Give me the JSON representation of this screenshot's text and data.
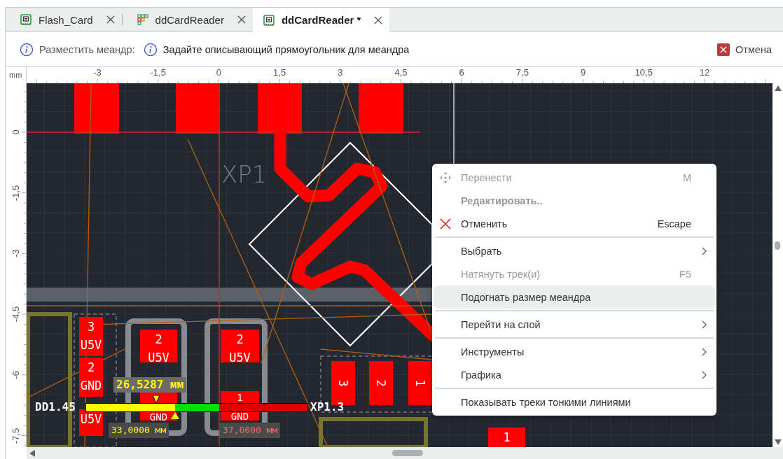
{
  "tabs": [
    {
      "label": "Flash_Card",
      "kind": "board",
      "selected": false
    },
    {
      "label": "ddCardReader",
      "kind": "schematic",
      "selected": false
    },
    {
      "label": "ddCardReader *",
      "kind": "board",
      "selected": true
    }
  ],
  "toolbar": {
    "command": "Разместить меандр:",
    "hint": "Задайте описывающий прямоугольник для меандра",
    "cancel": "Отмена"
  },
  "ruler": {
    "unit": "mm",
    "x_labels": [
      "-3",
      "-1,5",
      "0",
      "1,5",
      "3",
      "4,5",
      "6",
      "7,5",
      "9",
      "10,5",
      "12"
    ],
    "y_labels": [
      "0",
      "-1,5",
      "-3",
      "-4,5",
      "-6",
      "-7,5"
    ]
  },
  "canvas": {
    "designator": "XP1",
    "pads": [
      {
        "lines": [
          "3",
          "U5V"
        ],
        "kind": "h"
      },
      {
        "lines": [
          "2",
          "GND"
        ],
        "kind": "h"
      },
      {
        "lines": [
          "U5V"
        ],
        "kind": "h"
      },
      {
        "lines": [
          "2",
          "U5V"
        ],
        "kind": "h"
      },
      {
        "lines": [
          "GND"
        ],
        "kind": "h"
      },
      {
        "lines": [
          "2",
          "U5V"
        ],
        "kind": "h"
      },
      {
        "lines": [
          "1",
          "GND"
        ],
        "kind": "h"
      },
      {
        "lines": [
          "3"
        ],
        "kind": "v"
      },
      {
        "lines": [
          "2"
        ],
        "kind": "v"
      },
      {
        "lines": [
          "1"
        ],
        "kind": "v"
      },
      {
        "lines": [
          "1"
        ],
        "kind": "h"
      }
    ],
    "gauge": {
      "start": "DD1.45",
      "end": "XP1.3",
      "current": "26,5287 мм",
      "min": "33,0000 мм",
      "max": "37,0000 мм"
    }
  },
  "context_menu": {
    "groups": [
      [
        {
          "label": "Перенести",
          "shortcut": "M",
          "kind": "move",
          "disabled": true,
          "emphasized": false,
          "submenu": false,
          "highlighted": false
        },
        {
          "label": "Редактировать..",
          "kind": "plain",
          "disabled": true,
          "emphasized": true,
          "submenu": false,
          "highlighted": false
        },
        {
          "label": "Отменить",
          "shortcut": "Escape",
          "kind": "cancel",
          "disabled": false,
          "emphasized": false,
          "submenu": false,
          "highlighted": false
        }
      ],
      [
        {
          "label": "Выбрать",
          "kind": "plain",
          "disabled": false,
          "emphasized": false,
          "submenu": true,
          "highlighted": false
        },
        {
          "label": "Натянуть трек(и)",
          "shortcut": "F5",
          "kind": "plain",
          "disabled": true,
          "emphasized": false,
          "submenu": false,
          "highlighted": false
        },
        {
          "label": "Подогнать размер меандра",
          "kind": "plain",
          "disabled": false,
          "emphasized": false,
          "submenu": false,
          "highlighted": true
        }
      ],
      [
        {
          "label": "Перейти на слой",
          "kind": "plain",
          "disabled": false,
          "emphasized": false,
          "submenu": true,
          "highlighted": false
        }
      ],
      [
        {
          "label": "Инструменты",
          "kind": "plain",
          "disabled": false,
          "emphasized": false,
          "submenu": true,
          "highlighted": false
        },
        {
          "label": "Графика",
          "kind": "plain",
          "disabled": false,
          "emphasized": false,
          "submenu": true,
          "highlighted": false
        }
      ],
      [
        {
          "label": "Показывать треки тонкими линиями",
          "kind": "plain",
          "disabled": false,
          "emphasized": false,
          "submenu": false,
          "highlighted": false
        }
      ]
    ]
  }
}
